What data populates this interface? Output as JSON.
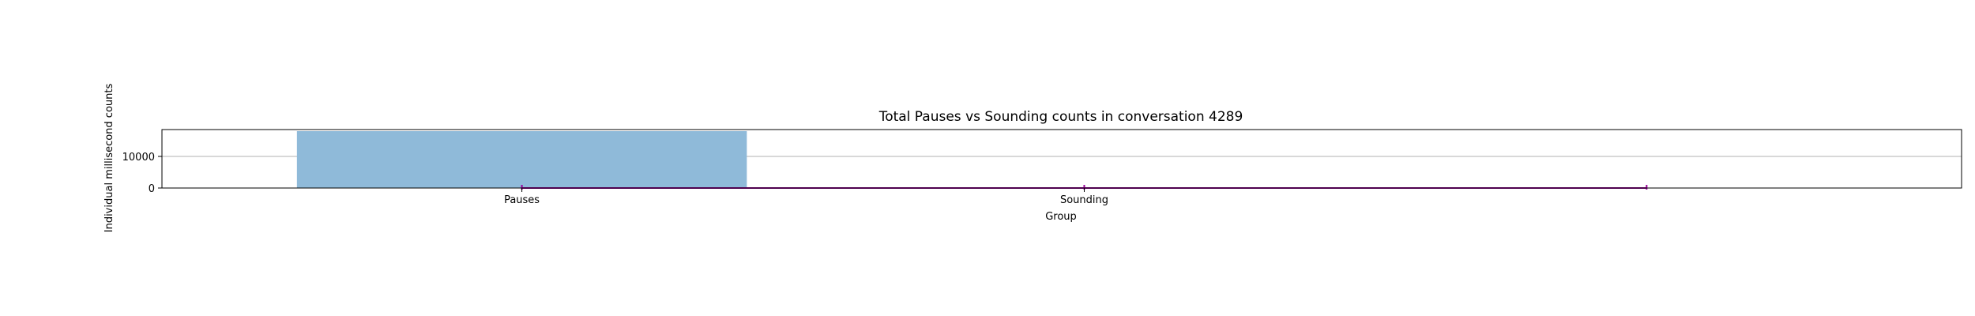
{
  "chart_data": {
    "type": "bar",
    "title": "Total Pauses vs Sounding counts in conversation 4289",
    "xlabel": "Group",
    "ylabel": "Individual millisecond counts",
    "categories": [
      "Pauses",
      "Sounding"
    ],
    "values": [
      18000,
      0
    ],
    "bar_color": "#8fbad9",
    "yticks": [
      0,
      10000
    ],
    "ylim": [
      0,
      18500
    ],
    "grid": true,
    "overlay_line": {
      "color": "#9b009b",
      "x": [
        0,
        1,
        2
      ],
      "y": [
        0,
        0,
        0
      ],
      "markers": "|"
    }
  }
}
